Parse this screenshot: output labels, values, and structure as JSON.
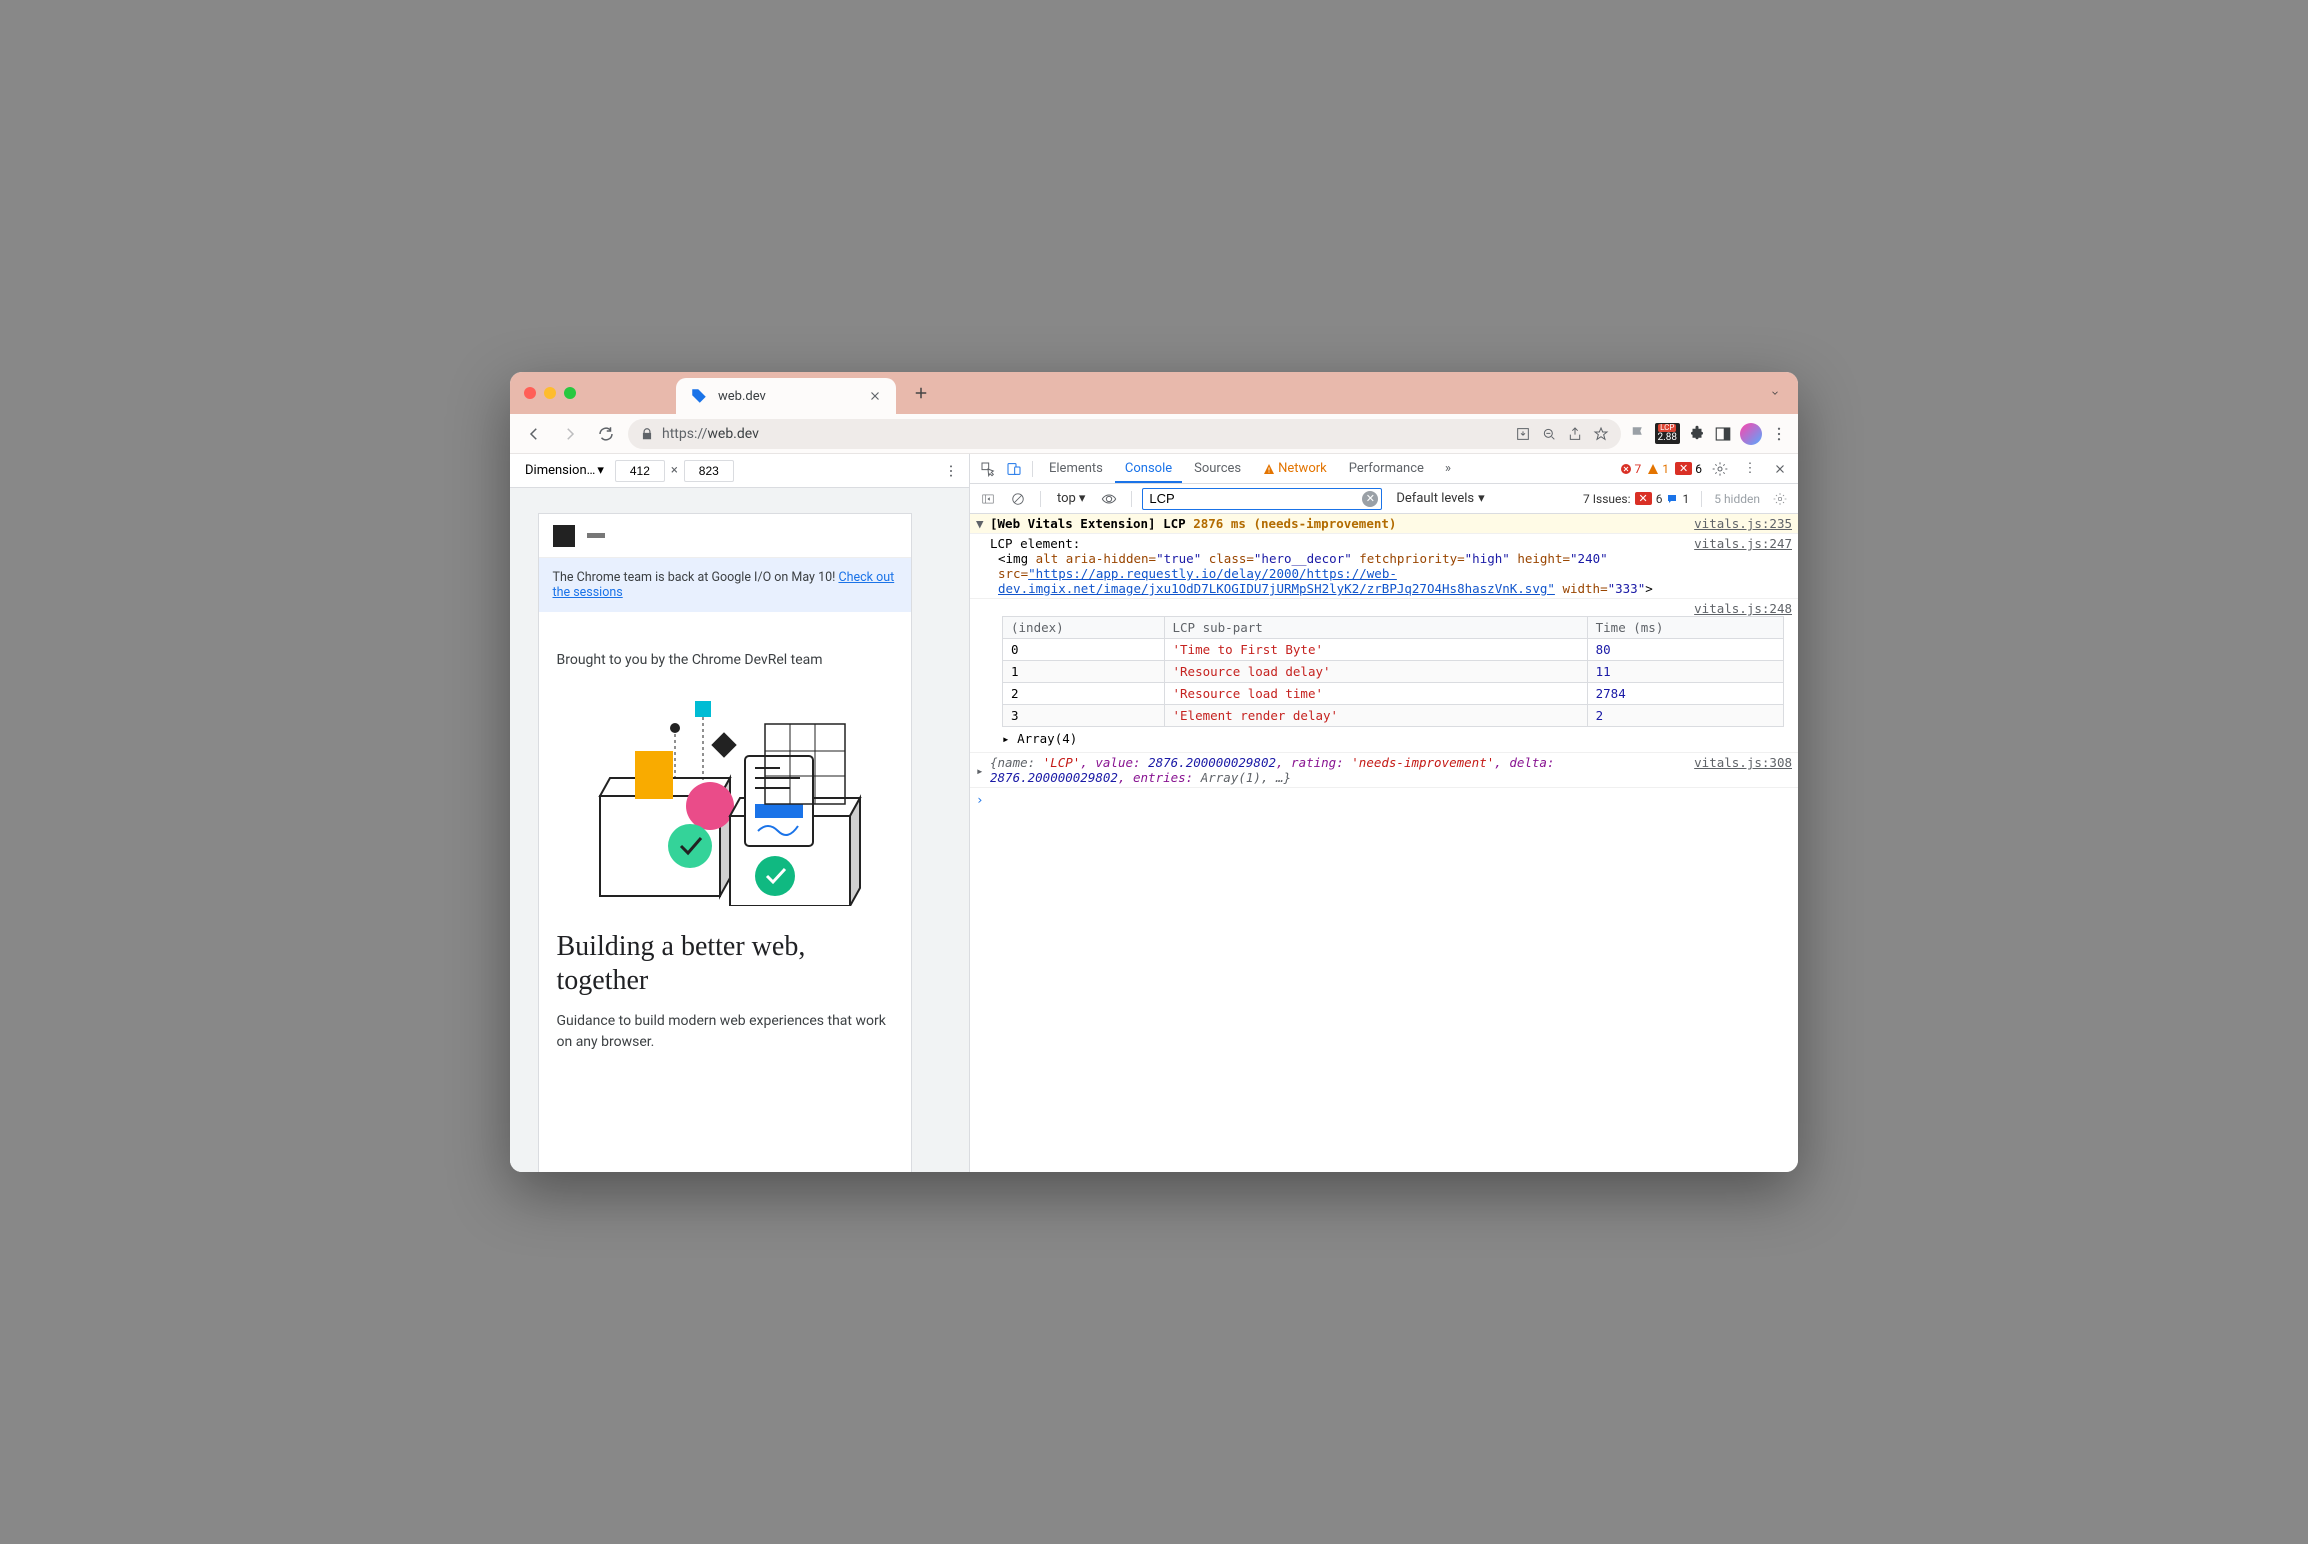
{
  "browser": {
    "tab_title": "web.dev",
    "url_proto": "https://",
    "url_rest": "web.dev",
    "ext_badge_top": "LCP",
    "ext_badge_val": "2.88"
  },
  "device": {
    "dim_label": "Dimension…",
    "width": "412",
    "height": "823"
  },
  "preview": {
    "banner_text": "The Chrome team is back at Google I/O on May 10! ",
    "banner_link": "Check out the sessions",
    "brought": "Brought to you by the Chrome DevRel team",
    "headline": "Building a better web, together",
    "subhead": "Guidance to build modern web experiences that work on any browser."
  },
  "devtools": {
    "tabs": {
      "elements": "Elements",
      "console": "Console",
      "sources": "Sources",
      "network": "Network",
      "performance": "Performance"
    },
    "err_count": "7",
    "warn_count": "1",
    "errbox_count": "6",
    "console": {
      "ctx": "top",
      "filter": "LCP",
      "levels": "Default levels",
      "issues_label": "7 Issues:",
      "issues_err": "6",
      "issues_info": "1",
      "hidden": "5 hidden"
    },
    "log1": {
      "prefix": "[Web Vitals Extension]",
      "metric": "LCP",
      "value": "2876 ms",
      "rating": "(needs-improvement)",
      "src": "vitals.js:235"
    },
    "log2": {
      "label": "LCP element:",
      "src": "vitals.js:247",
      "tag_open": "<img ",
      "alt_attr": "alt",
      "aria_attr": "aria-hidden=",
      "aria_val": "\"true\"",
      "class_attr": "class=",
      "class_val": "\"hero__decor\"",
      "fetch_attr": "fetchpriority=",
      "fetch_val": "\"high\"",
      "height_attr": "height=",
      "height_val": "\"240\"",
      "src_attr": "src=",
      "src_url": "\"https://app.requestly.io/delay/2000/https://web-dev.imgix.net/image/jxu1OdD7LKOGIDU7jURMpSH2lyK2/zrBPJq27O4Hs8haszVnK.svg\"",
      "width_attr": "width=",
      "width_val": "\"333\"",
      "tag_close": ">"
    },
    "table": {
      "src": "vitals.js:248",
      "headers": {
        "index": "(index)",
        "subpart": "LCP sub-part",
        "time": "Time (ms)"
      },
      "rows": [
        {
          "idx": "0",
          "part": "'Time to First Byte'",
          "time": "80"
        },
        {
          "idx": "1",
          "part": "'Resource load delay'",
          "time": "11"
        },
        {
          "idx": "2",
          "part": "'Resource load time'",
          "time": "2784"
        },
        {
          "idx": "3",
          "part": "'Element render delay'",
          "time": "2"
        }
      ],
      "array_label": "Array(4)"
    },
    "log3": {
      "src": "vitals.js:308",
      "text_pre": "{name: ",
      "name_val": "'LCP'",
      "value_key": ", value: ",
      "value_val": "2876.200000029802",
      "rating_key": ", rating: ",
      "rating_val": "'needs-improvement'",
      "delta_key": ", delta: ",
      "delta_val": "2876.200000029802",
      "entries_key": ", entries: ",
      "entries_val": "Array(1)",
      "tail": ", …}"
    }
  }
}
